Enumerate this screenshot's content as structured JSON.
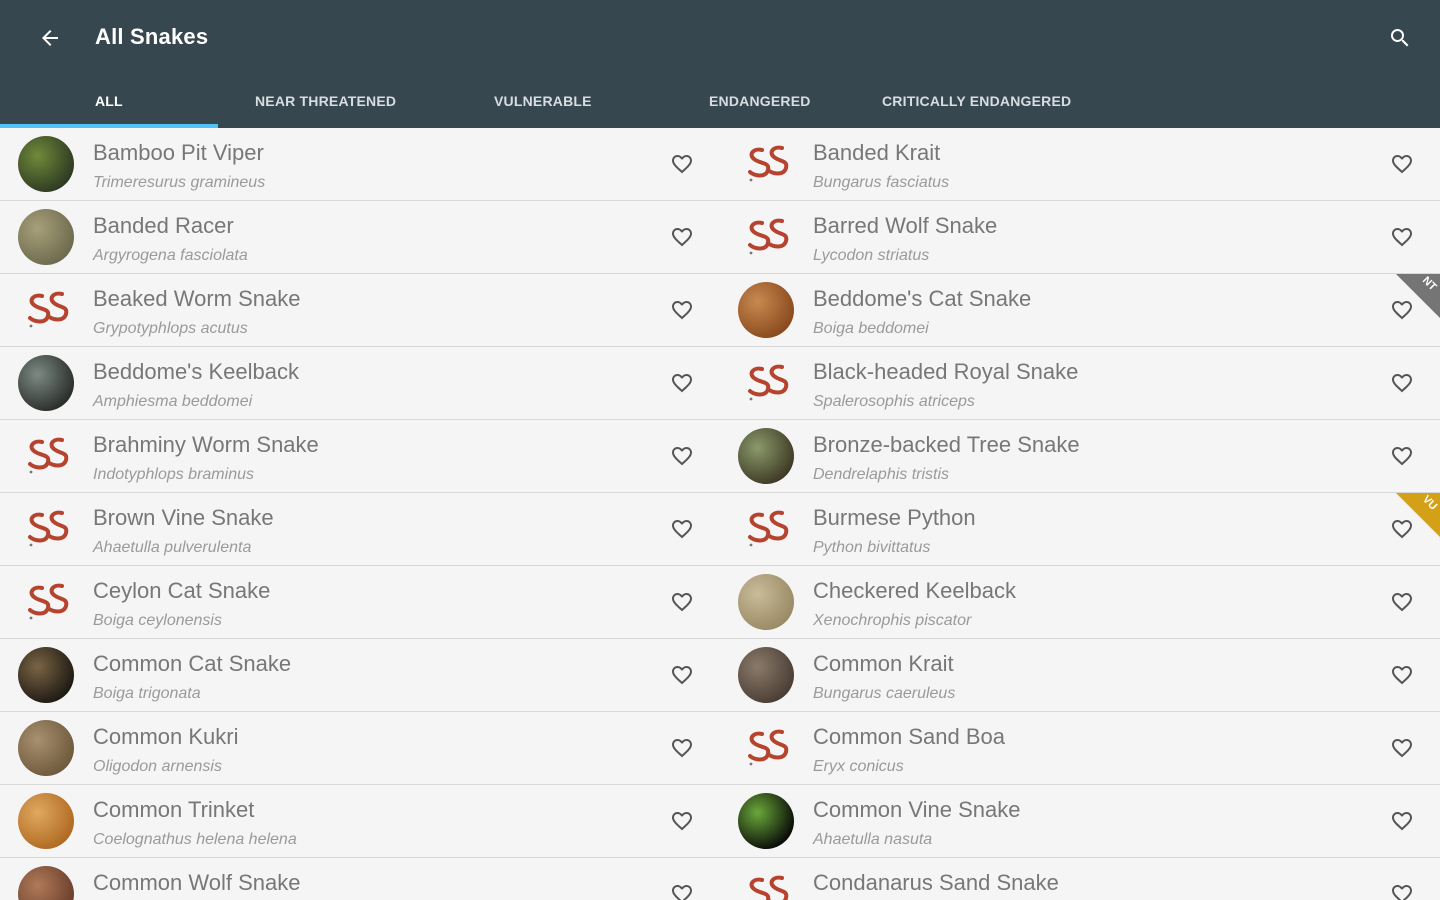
{
  "app": {
    "title": "All Snakes"
  },
  "icons": {
    "back": "arrow-back-icon",
    "search": "search-icon",
    "favorite": "heart-outline-icon"
  },
  "colors": {
    "appbar": "#37474f",
    "indicator": "#4fc3f7",
    "logo_red": "#b5432e",
    "nt_badge": "#757575",
    "en_badge": "#d4a017"
  },
  "tabs": [
    {
      "label": "ALL",
      "active": true
    },
    {
      "label": "NEAR THREATENED",
      "active": false
    },
    {
      "label": "VULNERABLE",
      "active": false
    },
    {
      "label": "ENDANGERED",
      "active": false
    },
    {
      "label": "CRITICALLY ENDANGERED",
      "active": false
    }
  ],
  "snakes": [
    {
      "name": "Bamboo Pit Viper",
      "scientific": "Trimeresurus gramineus",
      "avatar": "photo",
      "photo_colors": [
        "#2e3a22",
        "#6f8a3a"
      ]
    },
    {
      "name": "Banded Krait",
      "scientific": "Bungarus fasciatus",
      "avatar": "logo"
    },
    {
      "name": "Banded Racer",
      "scientific": "Argyrogena fasciolata",
      "avatar": "photo",
      "photo_colors": [
        "#6d6a4e",
        "#a8a07a"
      ]
    },
    {
      "name": "Barred Wolf Snake",
      "scientific": "Lycodon striatus",
      "avatar": "logo"
    },
    {
      "name": "Beaked Worm Snake",
      "scientific": "Grypotyphlops acutus",
      "avatar": "logo"
    },
    {
      "name": "Beddome's Cat Snake",
      "scientific": "Boiga beddomei",
      "avatar": "photo",
      "photo_colors": [
        "#8a4a1e",
        "#c88a50"
      ],
      "badge": "NT",
      "badge_color": "#757575"
    },
    {
      "name": "Beddome's Keelback",
      "scientific": "Amphiesma beddomei",
      "avatar": "photo",
      "photo_colors": [
        "#2a2e2a",
        "#7d8a84"
      ]
    },
    {
      "name": "Black-headed Royal Snake",
      "scientific": "Spalerosophis atriceps",
      "avatar": "logo"
    },
    {
      "name": "Brahminy Worm Snake",
      "scientific": "Indotyphlops braminus",
      "avatar": "logo"
    },
    {
      "name": "Bronze-backed Tree Snake",
      "scientific": "Dendrelaphis tristis",
      "avatar": "photo",
      "photo_colors": [
        "#3f3a26",
        "#8a9a6a"
      ]
    },
    {
      "name": "Brown Vine Snake",
      "scientific": "Ahaetulla pulverulenta",
      "avatar": "logo"
    },
    {
      "name": "Burmese Python",
      "scientific": "Python bivittatus",
      "avatar": "logo",
      "badge": "VU",
      "badge_color": "#d4a017"
    },
    {
      "name": "Ceylon Cat Snake",
      "scientific": "Boiga ceylonensis",
      "avatar": "logo"
    },
    {
      "name": "Checkered Keelback",
      "scientific": "Xenochrophis piscator",
      "avatar": "photo",
      "photo_colors": [
        "#9a8a66",
        "#c9bc98"
      ]
    },
    {
      "name": "Common Cat Snake",
      "scientific": "Boiga trigonata",
      "avatar": "photo",
      "photo_colors": [
        "#1e1a14",
        "#7a6444"
      ]
    },
    {
      "name": "Common Krait",
      "scientific": "Bungarus caeruleus",
      "avatar": "photo",
      "photo_colors": [
        "#4a3e34",
        "#8a7a6a"
      ]
    },
    {
      "name": "Common Kukri",
      "scientific": "Oligodon arnensis",
      "avatar": "photo",
      "photo_colors": [
        "#6e5a3c",
        "#a89070"
      ]
    },
    {
      "name": "Common Sand Boa",
      "scientific": "Eryx conicus",
      "avatar": "logo"
    },
    {
      "name": "Common Trinket",
      "scientific": "Coelognathus helena helena",
      "avatar": "photo",
      "photo_colors": [
        "#b06a22",
        "#e0a860"
      ]
    },
    {
      "name": "Common Vine Snake",
      "scientific": "Ahaetulla nasuta",
      "avatar": "photo",
      "photo_colors": [
        "#0a0c08",
        "#6aa83a"
      ]
    },
    {
      "name": "Common Wolf Snake",
      "scientific": "",
      "avatar": "photo",
      "photo_colors": [
        "#6a3e2a",
        "#b07a5a"
      ]
    },
    {
      "name": "Condanarus Sand Snake",
      "scientific": "",
      "avatar": "logo"
    }
  ]
}
